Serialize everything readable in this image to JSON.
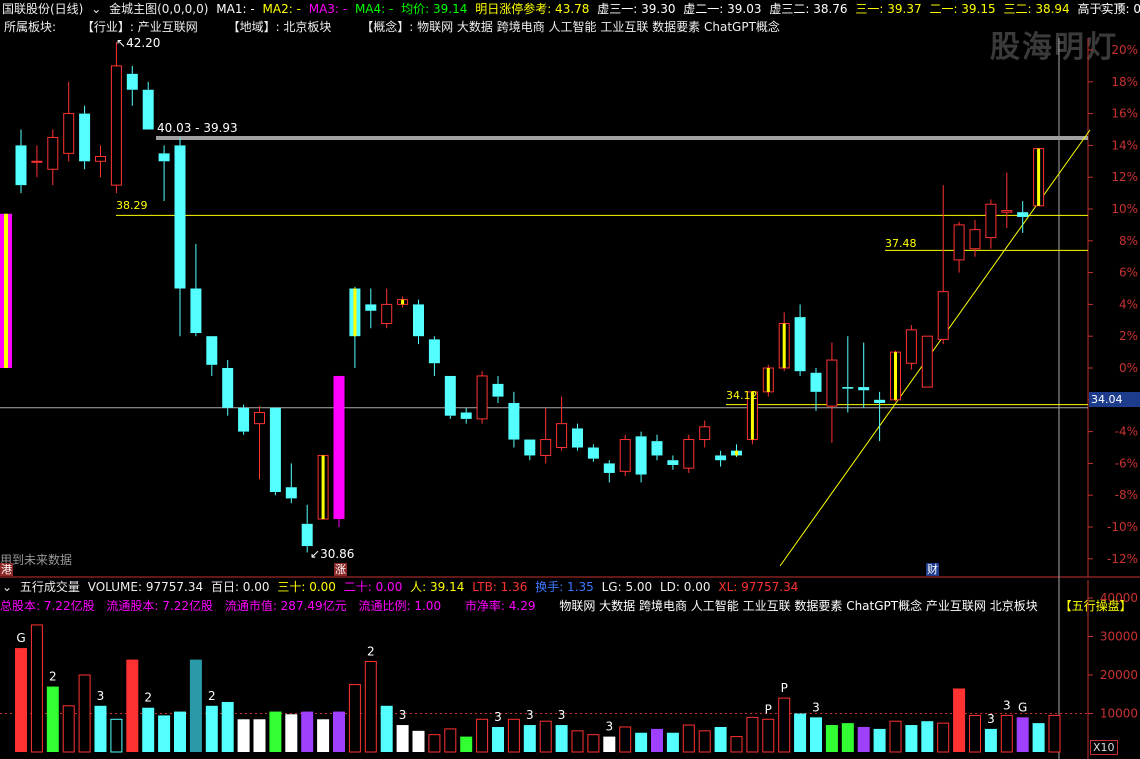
{
  "header": {
    "stock": "国联股份(日线)",
    "indicator_name": "金城主图(0,0,0,0)",
    "ma1": "MA1: -",
    "ma2": "MA2: -",
    "ma3": "MA3: -",
    "ma4": "MA4: -",
    "avg": "均价: 39.14",
    "limit": "明日涨停参考: 43.78",
    "x31": "虚三一: 39.30",
    "x21": "虚二一: 39.03",
    "x32": "虚三二: 38.76",
    "s31": "三一: 39.37",
    "s21": "二一: 39.15",
    "s32": "三二: 38.94",
    "gt": "高于实顶: 0.00"
  },
  "sectors": {
    "label": "所属板块:",
    "industry": "【行业】: 产业互联网",
    "region": "【地域】: 北京板块",
    "concept": "【概念】: 物联网 大数据 跨境电商 人工智能 工业互联 数据要素 ChatGPT概念"
  },
  "watermark": "股海明灯",
  "annotations": {
    "high": "42.20",
    "low": "30.86",
    "resist_range": "40.03 - 39.93",
    "lvl1": "38.29",
    "lvl2": "37.48",
    "lvl3": "34.12",
    "price_tag": "34.04",
    "future_note": "用到未来数据",
    "mark_zhang": "涨",
    "mark_cai": "财",
    "mark_gang": "港"
  },
  "colors": {
    "up": "#ff3232",
    "down": "#54ffff",
    "limit": "#ffff00",
    "magenta": "#ff00ff",
    "axis": "#c83232"
  },
  "volume_header": {
    "name": "五行成交量",
    "vol": "VOLUME: 97757.34",
    "b100": "百日: 0.00",
    "s30": "三十: 0.00",
    "s20": "二十: 0.00",
    "ren": "人: 39.14",
    "ltb": "LTB: 1.36",
    "hs": "换手: 1.35",
    "lg": "LG: 5.00",
    "ld": "LD: 0.00",
    "xl": "XL: 97757.34"
  },
  "volume_info": {
    "total": "总股本: 7.22亿股",
    "float": "流通股本: 7.22亿股",
    "mcap": "流通市值: 287.49亿元",
    "ratio": "流通比例: 1.00",
    "pb": "市净率: 4.29",
    "concepts": "物联网 大数据 跨境电商 人工智能 工业互联 数据要素 ChatGPT概念 产业互联网 北京板块",
    "tag": "【五行操盘】"
  },
  "volume_multiplier": "X10",
  "chart_data": [
    {
      "type": "candlestick",
      "y_unit": "% change from reference",
      "ylim": [
        -13,
        21
      ],
      "yticks": [
        "20%",
        "18%",
        "16%",
        "14%",
        "12%",
        "10%",
        "8%",
        "6%",
        "4%",
        "2%",
        "0%",
        "-2%",
        "-4%",
        "-6%",
        "-8%",
        "-10%",
        "-12%"
      ],
      "candles": [
        {
          "o": 14,
          "c": 11.5,
          "h": 15,
          "l": 11
        },
        {
          "o": 13,
          "c": 13,
          "h": 14,
          "l": 12
        },
        {
          "o": 12.5,
          "c": 14.5,
          "h": 15,
          "l": 11.5
        },
        {
          "o": 13.5,
          "c": 16,
          "h": 18,
          "l": 13
        },
        {
          "o": 16,
          "c": 13,
          "h": 16.5,
          "l": 12.5
        },
        {
          "o": 13,
          "c": 13.3,
          "h": 14,
          "l": 12
        },
        {
          "o": 11.5,
          "c": 19,
          "h": 20.5,
          "l": 11
        },
        {
          "o": 18.5,
          "c": 17.5,
          "h": 19,
          "l": 16.5
        },
        {
          "o": 17.5,
          "c": 15,
          "h": 18,
          "l": 15
        },
        {
          "o": 13.5,
          "c": 13,
          "h": 14,
          "l": 10.5
        },
        {
          "o": 14,
          "c": 5,
          "h": 14.5,
          "l": 2
        },
        {
          "o": 5,
          "c": 2.2,
          "h": 7.8,
          "l": 2
        },
        {
          "o": 2,
          "c": 0.2,
          "h": 2,
          "l": -0.5
        },
        {
          "o": 0,
          "c": -2.5,
          "h": 0.5,
          "l": -3
        },
        {
          "o": -2.5,
          "c": -4,
          "h": -2.3,
          "l": -4.2
        },
        {
          "o": -3.5,
          "c": -2.8,
          "h": -2.4,
          "l": -7
        },
        {
          "o": -2.5,
          "c": -7.8,
          "h": -2.5,
          "l": -8
        },
        {
          "o": -7.5,
          "c": -8.2,
          "h": -6,
          "l": -8.5
        },
        {
          "o": -9.8,
          "c": -11.2,
          "h": -8.6,
          "l": -11.6
        },
        {
          "o": -9.5,
          "c": -5.5,
          "h": -5.5,
          "l": -9.5,
          "flag": "limit"
        },
        {
          "o": -9.5,
          "c": -0.5,
          "h": -0.5,
          "l": -10,
          "flag": "magenta"
        },
        {
          "o": 5,
          "c": 2,
          "h": 5.1,
          "l": 0,
          "flag": "limit"
        },
        {
          "o": 4,
          "c": 3.6,
          "h": 5,
          "l": 2.5
        },
        {
          "o": 2.8,
          "c": 4,
          "h": 5,
          "l": 2.5
        },
        {
          "o": 4,
          "c": 4.3,
          "h": 4.5,
          "l": 3.8,
          "flag": "limit"
        },
        {
          "o": 4,
          "c": 2,
          "h": 4.3,
          "l": 1.5
        },
        {
          "o": 1.8,
          "c": 0.3,
          "h": 2,
          "l": -0.5
        },
        {
          "o": -0.5,
          "c": -3,
          "h": -0.5,
          "l": -3.2
        },
        {
          "o": -2.8,
          "c": -3.2,
          "h": -2.5,
          "l": -3.5
        },
        {
          "o": -3.2,
          "c": -0.5,
          "h": -0.2,
          "l": -3.5
        },
        {
          "o": -1,
          "c": -1.8,
          "h": -0.5,
          "l": -2.2
        },
        {
          "o": -2.2,
          "c": -4.5,
          "h": -1.5,
          "l": -5
        },
        {
          "o": -4.5,
          "c": -5.5,
          "h": -4.5,
          "l": -5.8
        },
        {
          "o": -5.5,
          "c": -4.5,
          "h": -2.5,
          "l": -6
        },
        {
          "o": -5,
          "c": -3.5,
          "h": -1.8,
          "l": -5.2
        },
        {
          "o": -3.8,
          "c": -5,
          "h": -3.5,
          "l": -5.2
        },
        {
          "o": -5,
          "c": -5.7,
          "h": -4.8,
          "l": -5.9
        },
        {
          "o": -6,
          "c": -6.6,
          "h": -5.8,
          "l": -7.2
        },
        {
          "o": -6.5,
          "c": -4.5,
          "h": -4.2,
          "l": -6.8
        },
        {
          "o": -4.3,
          "c": -6.7,
          "h": -4,
          "l": -7.2
        },
        {
          "o": -4.6,
          "c": -5.5,
          "h": -4.2,
          "l": -5.8
        },
        {
          "o": -5.8,
          "c": -6.1,
          "h": -5.5,
          "l": -6.4
        },
        {
          "o": -6.3,
          "c": -4.5,
          "h": -4.2,
          "l": -6.6
        },
        {
          "o": -4.5,
          "c": -3.7,
          "h": -3.3,
          "l": -5
        },
        {
          "o": -5.5,
          "c": -5.8,
          "h": -5.2,
          "l": -6.2
        },
        {
          "o": -5.2,
          "c": -5.5,
          "h": -4.8,
          "l": -5.6,
          "flag": "limit"
        },
        {
          "o": -4.5,
          "c": -1.5,
          "h": -1.5,
          "l": -4.8,
          "flag": "limit"
        },
        {
          "o": -1.5,
          "c": 0,
          "h": 0.2,
          "l": -1.8,
          "flag": "limit"
        },
        {
          "o": 0,
          "c": 2.8,
          "h": 3.5,
          "l": -0.2,
          "flag": "limit"
        },
        {
          "o": 3.2,
          "c": -0.2,
          "h": 4,
          "l": -0.5
        },
        {
          "o": -0.3,
          "c": -1.5,
          "h": 0,
          "l": -2.7
        },
        {
          "o": -2.4,
          "c": 0.5,
          "h": 1.6,
          "l": -4.7
        },
        {
          "o": -1.2,
          "c": -1.3,
          "h": 2,
          "l": -2.8
        },
        {
          "o": -1.2,
          "c": -1.4,
          "h": 1.6,
          "l": -2.5
        },
        {
          "o": -2,
          "c": -2.2,
          "h": -1.5,
          "l": -4.6
        },
        {
          "o": -2,
          "c": 1,
          "h": 1.1,
          "l": -2.1,
          "flag": "limit"
        },
        {
          "o": 0.3,
          "c": 2.4,
          "h": 2.7,
          "l": -0.1
        },
        {
          "o": -1.2,
          "c": 2,
          "h": 2,
          "l": -1.2
        },
        {
          "o": 1.8,
          "c": 4.8,
          "h": 11.5,
          "l": 1.5
        },
        {
          "o": 6.8,
          "c": 9,
          "h": 9.2,
          "l": 6
        },
        {
          "o": 7.5,
          "c": 8.7,
          "h": 9.3,
          "l": 7
        },
        {
          "o": 8.2,
          "c": 10.3,
          "h": 10.6,
          "l": 7.5
        },
        {
          "o": 9.8,
          "c": 9.9,
          "h": 12.3,
          "l": 8.8
        },
        {
          "o": 9.8,
          "c": 9.5,
          "h": 10.5,
          "l": 8.5
        },
        {
          "o": 10.2,
          "c": 13.8,
          "h": 13.8,
          "l": 10.2,
          "flag": "limit"
        }
      ],
      "levels": [
        {
          "label": "38.29",
          "y": 9.6
        },
        {
          "label": "37.48",
          "y": 7.4
        },
        {
          "label": "34.12",
          "y": -2.3
        },
        {
          "label": "34.04",
          "y": -2.5
        }
      ]
    },
    {
      "type": "bar",
      "title": "五行成交量",
      "ylim": [
        0,
        45000
      ],
      "yticks": [
        "40000",
        "30000",
        "20000",
        "10000"
      ],
      "values": [
        27000,
        33000,
        17000,
        12000,
        20000,
        12000,
        8500,
        24000,
        11500,
        9500,
        10500,
        24000,
        12000,
        13000,
        8500,
        8500,
        10500,
        9800,
        10500,
        8500,
        10500,
        17500,
        23500,
        12000,
        7000,
        5500,
        4500,
        6000,
        4000,
        8500,
        6500,
        8500,
        7000,
        8000,
        7000,
        5500,
        4500,
        4000,
        6500,
        5000,
        6000,
        5000,
        7000,
        5500,
        6500,
        4000,
        9000,
        8500,
        14000,
        10000,
        9000,
        7000,
        7500,
        6500,
        6000,
        8000,
        7000,
        8000,
        7500,
        16500,
        9500,
        6000,
        9500,
        9000,
        7500,
        9500
      ],
      "labels": {
        "0": "G",
        "2": "2",
        "5": "3",
        "8": "2",
        "12": "2",
        "24": "3",
        "47": "P",
        "48": "P",
        "50": "3",
        "61": "3",
        "62": "3",
        "63": "G",
        "1": "",
        "22": "2",
        "30": "3",
        "32": "3",
        "34": "3",
        "37": "3"
      }
    }
  ]
}
